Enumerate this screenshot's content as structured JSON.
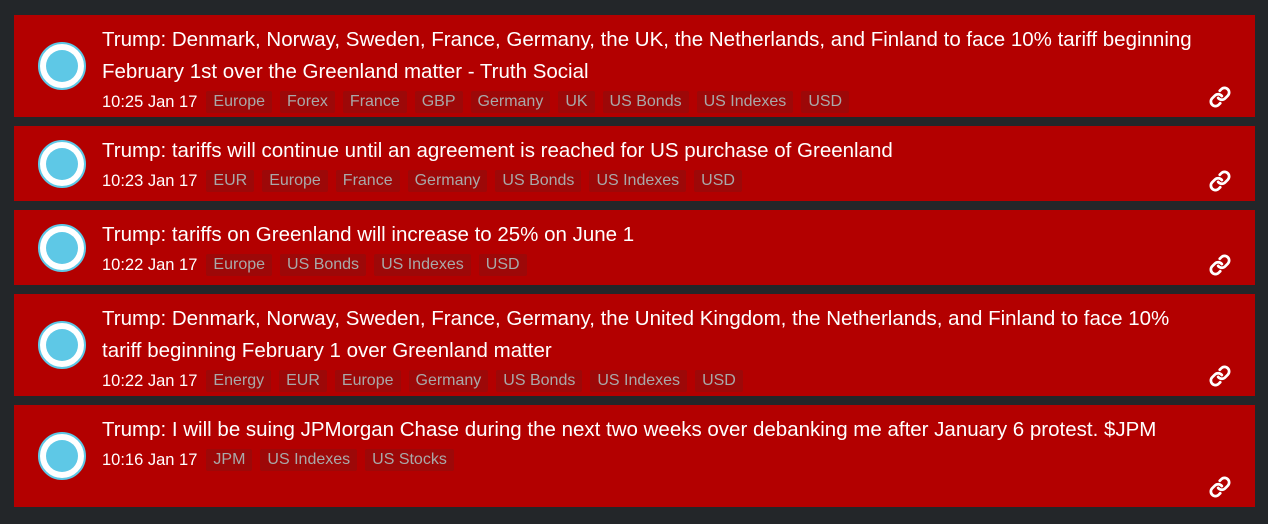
{
  "feed": {
    "items": [
      {
        "headline": "Trump: Denmark, Norway, Sweden, France, Germany, the UK, the Netherlands, and Finland to face 10% tariff beginning February 1st over the Greenland matter - Truth Social",
        "time": "10:25 Jan 17",
        "tags": [
          "Europe",
          "Forex",
          "France",
          "GBP",
          "Germany",
          "UK",
          "US Bonds",
          "US Indexes",
          "USD"
        ]
      },
      {
        "headline": "Trump: tariffs will continue until an agreement is reached for US purchase of Greenland",
        "time": "10:23 Jan 17",
        "tags": [
          "EUR",
          "Europe",
          "France",
          "Germany",
          "US Bonds",
          "US Indexes",
          "USD"
        ]
      },
      {
        "headline": "Trump: tariffs on Greenland will increase to 25% on June 1",
        "time": "10:22 Jan 17",
        "tags": [
          "Europe",
          "US Bonds",
          "US Indexes",
          "USD"
        ]
      },
      {
        "headline": "Trump: Denmark, Norway, Sweden, France, Germany, the United Kingdom, the Netherlands, and Finland to face 10% tariff beginning February 1 over Greenland matter",
        "time": "10:22 Jan 17",
        "tags": [
          "Energy",
          "EUR",
          "Europe",
          "Germany",
          "US Bonds",
          "US Indexes",
          "USD"
        ]
      },
      {
        "headline": "Trump: I will be suing JPMorgan Chase during the next two weeks over debanking me after January 6 protest. $JPM",
        "time": "10:16 Jan 17",
        "tags": [
          "JPM",
          "US Indexes",
          "US Stocks"
        ]
      }
    ]
  },
  "colors": {
    "page_bg": "#232629",
    "item_bg": "#b30000",
    "tag_bg": "#9d0808",
    "tag_text": "#a9a9a9",
    "dot_accent": "#5ec8e6"
  },
  "icons": {
    "item_marker": "circle-indicator-icon",
    "item_action": "link-icon"
  }
}
